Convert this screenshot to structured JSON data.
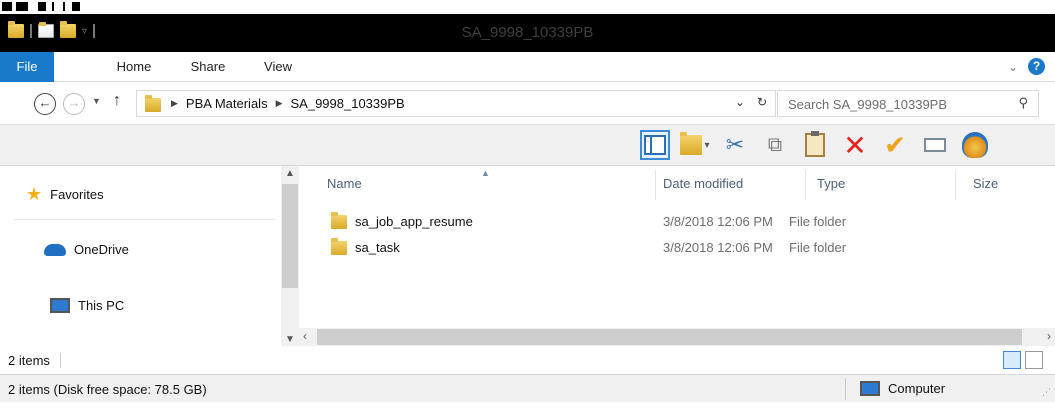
{
  "window": {
    "title": "SA_9998_10339PB"
  },
  "ribbon": {
    "tabs": [
      {
        "label": "File"
      },
      {
        "label": "Home"
      },
      {
        "label": "Share"
      },
      {
        "label": "View"
      }
    ],
    "help_label": "?"
  },
  "address": {
    "breadcrumb": [
      "PBA Materials",
      "SA_9998_10339PB"
    ],
    "refresh_icon": "refresh-icon"
  },
  "search": {
    "placeholder": "Search SA_9998_10339PB",
    "value": ""
  },
  "toolbar": {
    "icons": [
      "preview-pane-icon",
      "properties-icon",
      "cut-icon",
      "copy-icon",
      "paste-icon",
      "delete-icon",
      "checkmark-icon",
      "email-icon",
      "shell-icon"
    ]
  },
  "navpane": {
    "items": [
      {
        "label": "Favorites",
        "icon": "star-icon"
      },
      {
        "label": "OneDrive",
        "icon": "cloud-icon"
      },
      {
        "label": "This PC",
        "icon": "computer-icon"
      }
    ]
  },
  "filelist": {
    "columns": {
      "name": "Name",
      "date": "Date modified",
      "type": "Type",
      "size": "Size"
    },
    "rows": [
      {
        "name": "sa_job_app_resume",
        "date": "3/8/2018 12:06 PM",
        "type": "File folder"
      },
      {
        "name": "sa_task",
        "date": "3/8/2018 12:06 PM",
        "type": "File folder"
      }
    ]
  },
  "countbar": {
    "count": "2 items"
  },
  "statusbar": {
    "info": "2 items (Disk free space: 78.5 GB)",
    "location": "Computer"
  },
  "colors": {
    "accent": "#1979ca",
    "folder": "#e8bf4a",
    "titlebar": "#000000"
  }
}
